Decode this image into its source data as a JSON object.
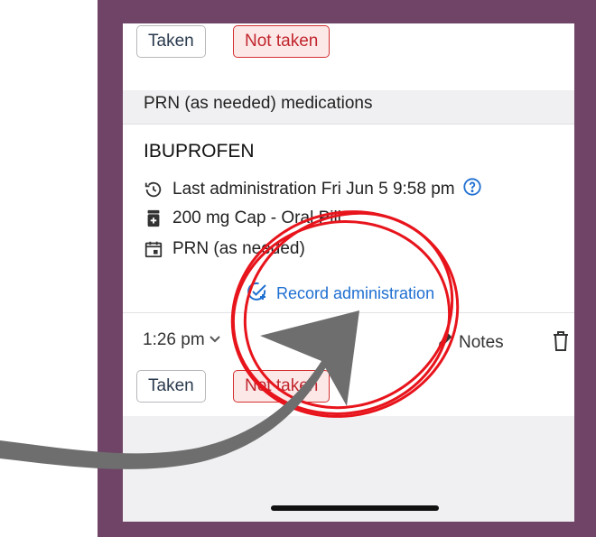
{
  "top_card": {
    "taken_label": "Taken",
    "not_taken_label": "Not taken"
  },
  "section": {
    "title": "PRN (as needed) medications"
  },
  "medication": {
    "name": "IBUPROFEN",
    "last_admin": "Last administration Fri Jun 5 9:58 pm",
    "dose": "200 mg Cap - Oral Pill",
    "schedule": "PRN (as needed)",
    "record_label": "Record administration",
    "time": "1:26 pm",
    "notes_label": "Notes",
    "taken_label": "Taken",
    "not_taken_label": "Not taken"
  },
  "icons": {
    "history": "history-icon",
    "help": "help-circle-icon",
    "pill": "pill-bottle-icon",
    "calendar": "calendar-icon",
    "record": "record-plus-check-icon",
    "chevron": "chevron-down-icon",
    "pencil": "pencil-icon",
    "trash": "trash-icon"
  },
  "colors": {
    "frame": "#6f4467",
    "accent_blue": "#1f6fd1",
    "not_taken_red": "#d33030",
    "annotation_red": "#e8141c",
    "annotation_arrow": "#6e6e6e"
  }
}
